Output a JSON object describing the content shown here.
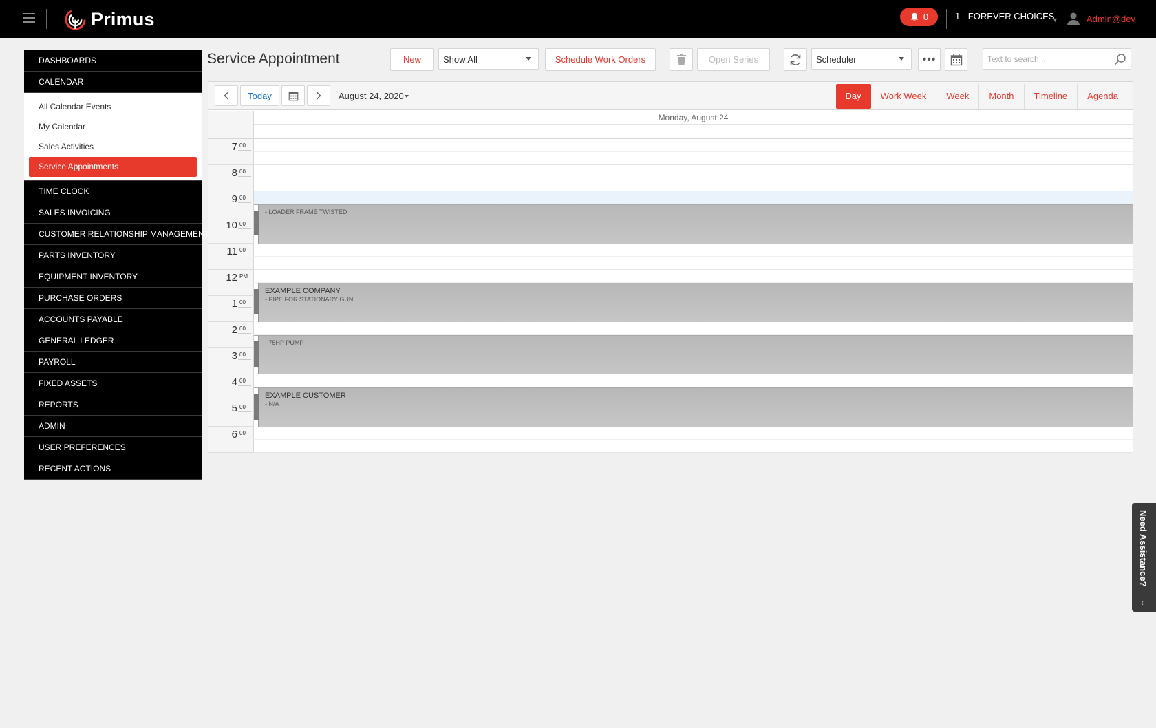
{
  "header": {
    "logo_text": "Primus",
    "notification_count": "0",
    "company": "1 - FOREVER CHOICES",
    "user": "Admin@dev"
  },
  "sidebar": {
    "items_top": [
      {
        "label": "DASHBOARDS"
      },
      {
        "label": "CALENDAR"
      }
    ],
    "calendar_sub": [
      {
        "label": "All Calendar Events"
      },
      {
        "label": "My Calendar"
      },
      {
        "label": "Sales Activities"
      },
      {
        "label": "Service Appointments"
      }
    ],
    "items_bottom": [
      {
        "label": "TIME CLOCK"
      },
      {
        "label": "SALES INVOICING"
      },
      {
        "label": "CUSTOMER RELATIONSHIP MANAGEMENT"
      },
      {
        "label": "PARTS INVENTORY"
      },
      {
        "label": "EQUIPMENT INVENTORY"
      },
      {
        "label": "PURCHASE ORDERS"
      },
      {
        "label": "ACCOUNTS PAYABLE"
      },
      {
        "label": "GENERAL LEDGER"
      },
      {
        "label": "PAYROLL"
      },
      {
        "label": "FIXED ASSETS"
      },
      {
        "label": "REPORTS"
      },
      {
        "label": "ADMIN"
      },
      {
        "label": "USER PREFERENCES"
      },
      {
        "label": "RECENT ACTIONS"
      }
    ]
  },
  "toolbar": {
    "title": "Service Appointment",
    "new_label": "New",
    "filter_value": "Show All",
    "schedule_label": "Schedule Work Orders",
    "open_series_label": "Open Series",
    "view_select_value": "Scheduler",
    "search_placeholder": "Text to search..."
  },
  "scheduler": {
    "today_label": "Today",
    "date": "August 24, 2020",
    "views": [
      "Day",
      "Work Week",
      "Week",
      "Month",
      "Timeline",
      "Agenda"
    ],
    "active_view": "Day",
    "day_header": "Monday, August 24",
    "hours": [
      {
        "num": "7",
        "min": "00"
      },
      {
        "num": "8",
        "min": "00"
      },
      {
        "num": "9",
        "min": "00"
      },
      {
        "num": "10",
        "min": "00"
      },
      {
        "num": "11",
        "min": "00"
      },
      {
        "num": "12",
        "min": "PM"
      },
      {
        "num": "1",
        "min": "00"
      },
      {
        "num": "2",
        "min": "00"
      },
      {
        "num": "3",
        "min": "00"
      },
      {
        "num": "4",
        "min": "00"
      },
      {
        "num": "5",
        "min": "00"
      },
      {
        "num": "6",
        "min": "00"
      }
    ],
    "appointments": [
      {
        "title": "",
        "description": "- LOADER FRAME TWISTED"
      },
      {
        "title": "EXAMPLE COMPANY",
        "description": "- PIPE FOR STATIONARY GUN"
      },
      {
        "title": "",
        "description": "- 75HP PUMP"
      },
      {
        "title": "EXAMPLE CUSTOMER",
        "description": "- N/A"
      }
    ]
  },
  "assist": {
    "label": "Need Assistance?"
  },
  "colors": {
    "accent": "#e8392d",
    "topbar": "#000000",
    "appointment": "#bfbfbf"
  }
}
